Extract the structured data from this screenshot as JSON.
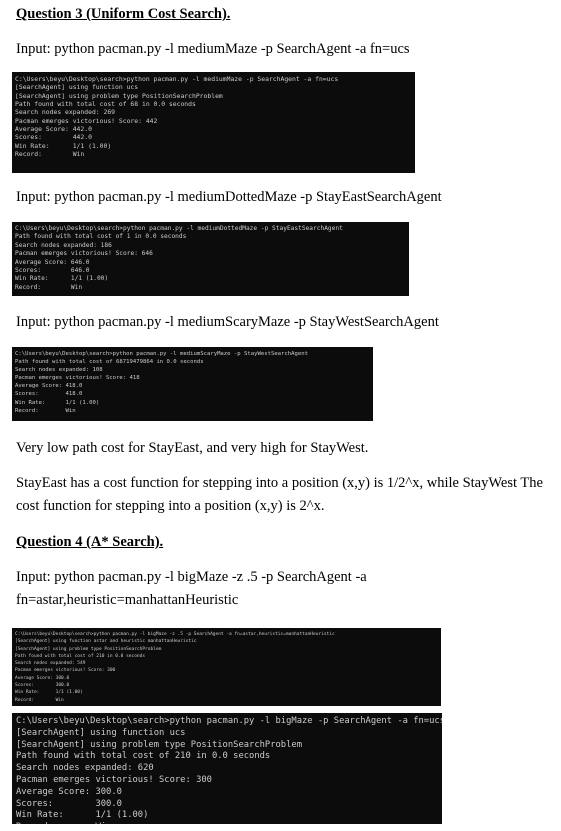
{
  "q3": {
    "heading": "Question 3 (Uniform Cost Search).",
    "input1": "Input: python pacman.py -l mediumMaze -p SearchAgent -a fn=ucs",
    "terminal1": [
      "C:\\Users\\beyu\\Desktop\\search>python pacman.py -l mediumMaze -p SearchAgent -a fn=ucs",
      "[SearchAgent] using function ucs",
      "[SearchAgent] using problem type PositionSearchProblem",
      "Path found with total cost of 68 in 0.0 seconds",
      "Search nodes expanded: 269",
      "Pacman emerges victorious! Score: 442",
      "Average Score: 442.0",
      "Scores:        442.0",
      "Win Rate:      1/1 (1.00)",
      "Record:        Win"
    ],
    "input2": "Input: python pacman.py -l mediumDottedMaze -p StayEastSearchAgent",
    "terminal2": [
      "C:\\Users\\beyu\\Desktop\\search>python pacman.py -l mediumDottedMaze -p StayEastSearchAgent",
      "Path found with total cost of 1 in 0.0 seconds",
      "Search nodes expanded: 186",
      "Pacman emerges victorious! Score: 646",
      "Average Score: 646.0",
      "Scores:        646.0",
      "Win Rate:      1/1 (1.00)",
      "Record:        Win"
    ],
    "input3": "Input: python pacman.py -l mediumScaryMaze -p StayWestSearchAgent",
    "terminal3": [
      "C:\\Users\\beyu\\Desktop\\search>python pacman.py -l mediumScaryMaze -p StayWestSearchAgent",
      "Path found with total cost of 68719479864 in 0.0 seconds",
      "Search nodes expanded: 108",
      "Pacman emerges victorious! Score: 418",
      "Average Score: 418.0",
      "Scores:        418.0",
      "Win Rate:      1/1 (1.00)",
      "Record:        Win"
    ],
    "observation": "Very low path cost for StayEast, and very high for StayWest.",
    "explanation": "StayEast has a cost function for stepping into a position (x,y) is 1/2^x, while StayWest The cost function for stepping into a position (x,y) is 2^x."
  },
  "q4": {
    "heading": "Question 4 (A* Search).",
    "input": "Input: python pacman.py -l bigMaze -z .5 -p SearchAgent -a fn=astar,heuristic=manhattanHeuristic",
    "terminal4": [
      "C:\\Users\\beyu\\Desktop\\search>python pacman.py -l bigMaze -z .5 -p SearchAgent -a fn=astar,heuristic=manhattanHeuristic",
      "[SearchAgent] using function astar and heuristic manhattanHeuristic",
      "[SearchAgent] using problem type PositionSearchProblem",
      "Path found with total cost of 210 in 0.0 seconds",
      "Search nodes expanded: 549",
      "Pacman emerges victorious! Score: 300",
      "Average Score: 300.0",
      "Scores:        300.0",
      "Win Rate:      1/1 (1.00)",
      "Record:        Win"
    ],
    "terminal5": [
      "C:\\Users\\beyu\\Desktop\\search>python pacman.py -l bigMaze -p SearchAgent -a fn=ucs",
      "[SearchAgent] using function ucs",
      "[SearchAgent] using problem type PositionSearchProblem",
      "Path found with total cost of 210 in 0.0 seconds",
      "Search nodes expanded: 620",
      "Pacman emerges victorious! Score: 300",
      "Average Score: 300.0",
      "Scores:        300.0",
      "Win Rate:      1/1 (1.00)",
      "Record:        Win"
    ]
  }
}
